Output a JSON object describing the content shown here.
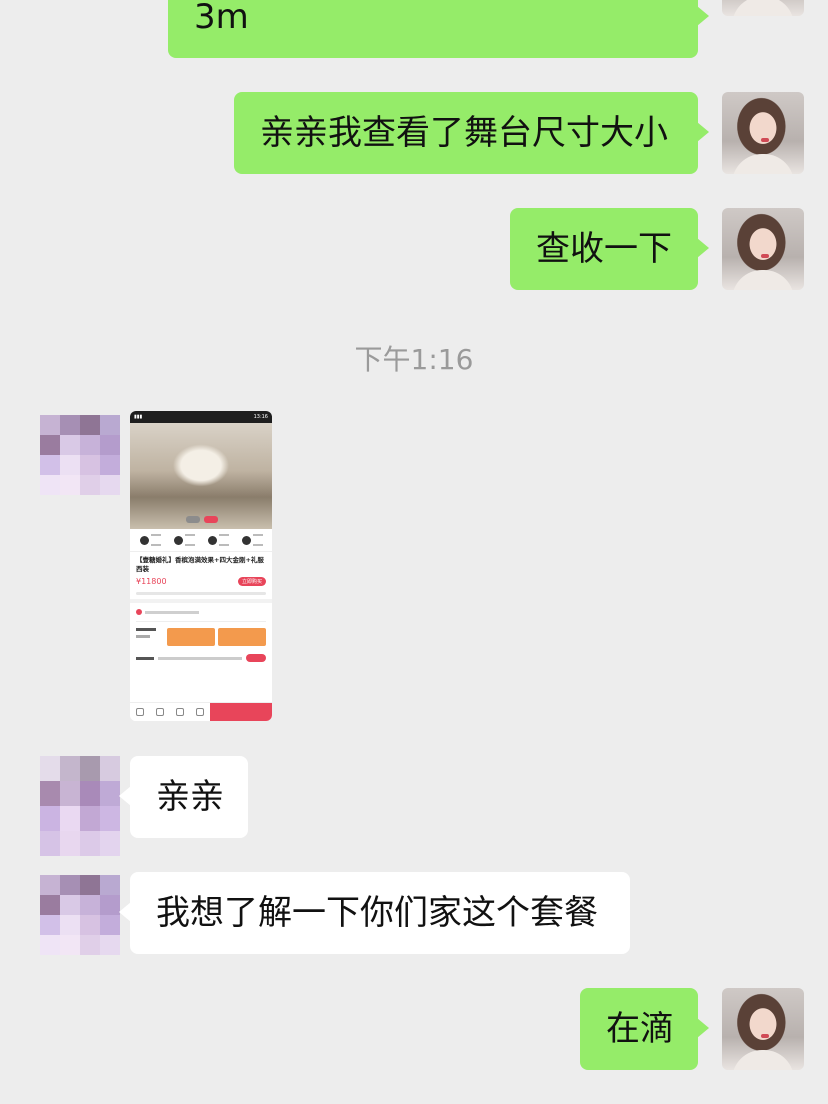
{
  "messages": {
    "m1": "3m",
    "m2": "亲亲我查看了舞台尺寸大小",
    "m3": "查收一下",
    "timestamp": "下午1:16",
    "m4": "亲亲",
    "m5": "我想了解一下你们家这个套餐",
    "m6": "在滴"
  },
  "shared_image": {
    "title": "【壹糖婚礼】香槟泡满效果+四大金刚+礼服西装",
    "price": "¥11800",
    "buy_label": "立即购买",
    "status_time": "13:16"
  },
  "colors": {
    "background": "#ededed",
    "outgoing_bubble": "#95ec69",
    "incoming_bubble": "#ffffff",
    "timestamp": "#9a9a9a",
    "accent": "#e8455a"
  }
}
